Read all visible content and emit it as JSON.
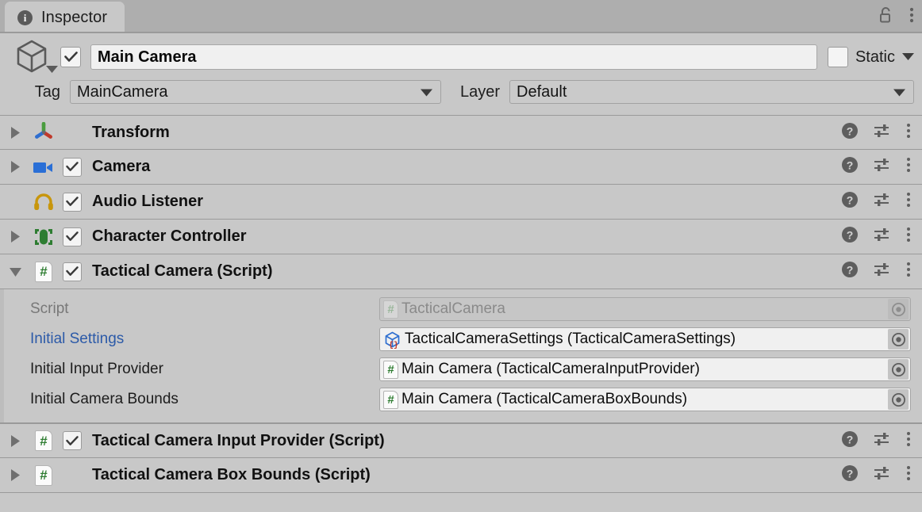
{
  "window": {
    "tab_label": "Inspector",
    "tab_icon": "info-icon",
    "lock_icon": "padlock-unlocked-icon",
    "menu_icon": "kebab-menu-icon"
  },
  "object_header": {
    "gameobject_icon": "cube-icon",
    "enabled": true,
    "name": "Main Camera",
    "static_label": "Static",
    "static_checked": false,
    "tag_label": "Tag",
    "tag_value": "MainCamera",
    "layer_label": "Layer",
    "layer_value": "Default"
  },
  "components": [
    {
      "title": "Transform",
      "icon": "transform-gizmo-icon",
      "has_foldout": true,
      "expanded": false,
      "has_checkbox": false,
      "enabled": false
    },
    {
      "title": "Camera",
      "icon": "camera-icon",
      "has_foldout": true,
      "expanded": false,
      "has_checkbox": true,
      "enabled": true
    },
    {
      "title": "Audio Listener",
      "icon": "headphones-icon",
      "has_foldout": false,
      "expanded": false,
      "has_checkbox": true,
      "enabled": true
    },
    {
      "title": "Character Controller",
      "icon": "character-controller-icon",
      "has_foldout": true,
      "expanded": false,
      "has_checkbox": true,
      "enabled": true
    },
    {
      "title": "Tactical Camera (Script)",
      "icon": "csharp-script-icon",
      "has_foldout": true,
      "expanded": true,
      "has_checkbox": true,
      "enabled": true,
      "properties": [
        {
          "label": "Script",
          "label_style": "dim",
          "value": "TacticalCamera",
          "value_icon": "csharp-script-icon",
          "disabled": true
        },
        {
          "label": "Initial Settings",
          "label_style": "link",
          "value": "TacticalCameraSettings (TacticalCameraSettings)",
          "value_icon": "scriptable-object-icon",
          "disabled": false
        },
        {
          "label": "Initial Input Provider",
          "label_style": "normal",
          "value": "Main Camera (TacticalCameraInputProvider)",
          "value_icon": "csharp-script-icon",
          "disabled": false
        },
        {
          "label": "Initial Camera Bounds",
          "label_style": "normal",
          "value": "Main Camera (TacticalCameraBoxBounds)",
          "value_icon": "csharp-script-icon",
          "disabled": false
        }
      ]
    },
    {
      "title": "Tactical Camera Input Provider (Script)",
      "icon": "csharp-script-icon",
      "has_foldout": true,
      "expanded": false,
      "has_checkbox": true,
      "enabled": true
    },
    {
      "title": "Tactical Camera Box Bounds (Script)",
      "icon": "csharp-script-icon",
      "has_foldout": true,
      "expanded": false,
      "has_checkbox": false,
      "enabled": false
    }
  ],
  "component_tools": {
    "help_icon": "help-icon",
    "preset_icon": "preset-sliders-icon",
    "menu_icon": "kebab-menu-icon"
  },
  "colors": {
    "panel_bg": "#c8c8c8",
    "tabbar_bg": "#aeaeae",
    "separator": "#9a9a9a",
    "link_blue": "#2c5aa8",
    "script_green": "#2f7d32",
    "camera_blue": "#2a6fd6",
    "headphones_gold": "#c8960c",
    "controller_green": "#2e7d32"
  }
}
